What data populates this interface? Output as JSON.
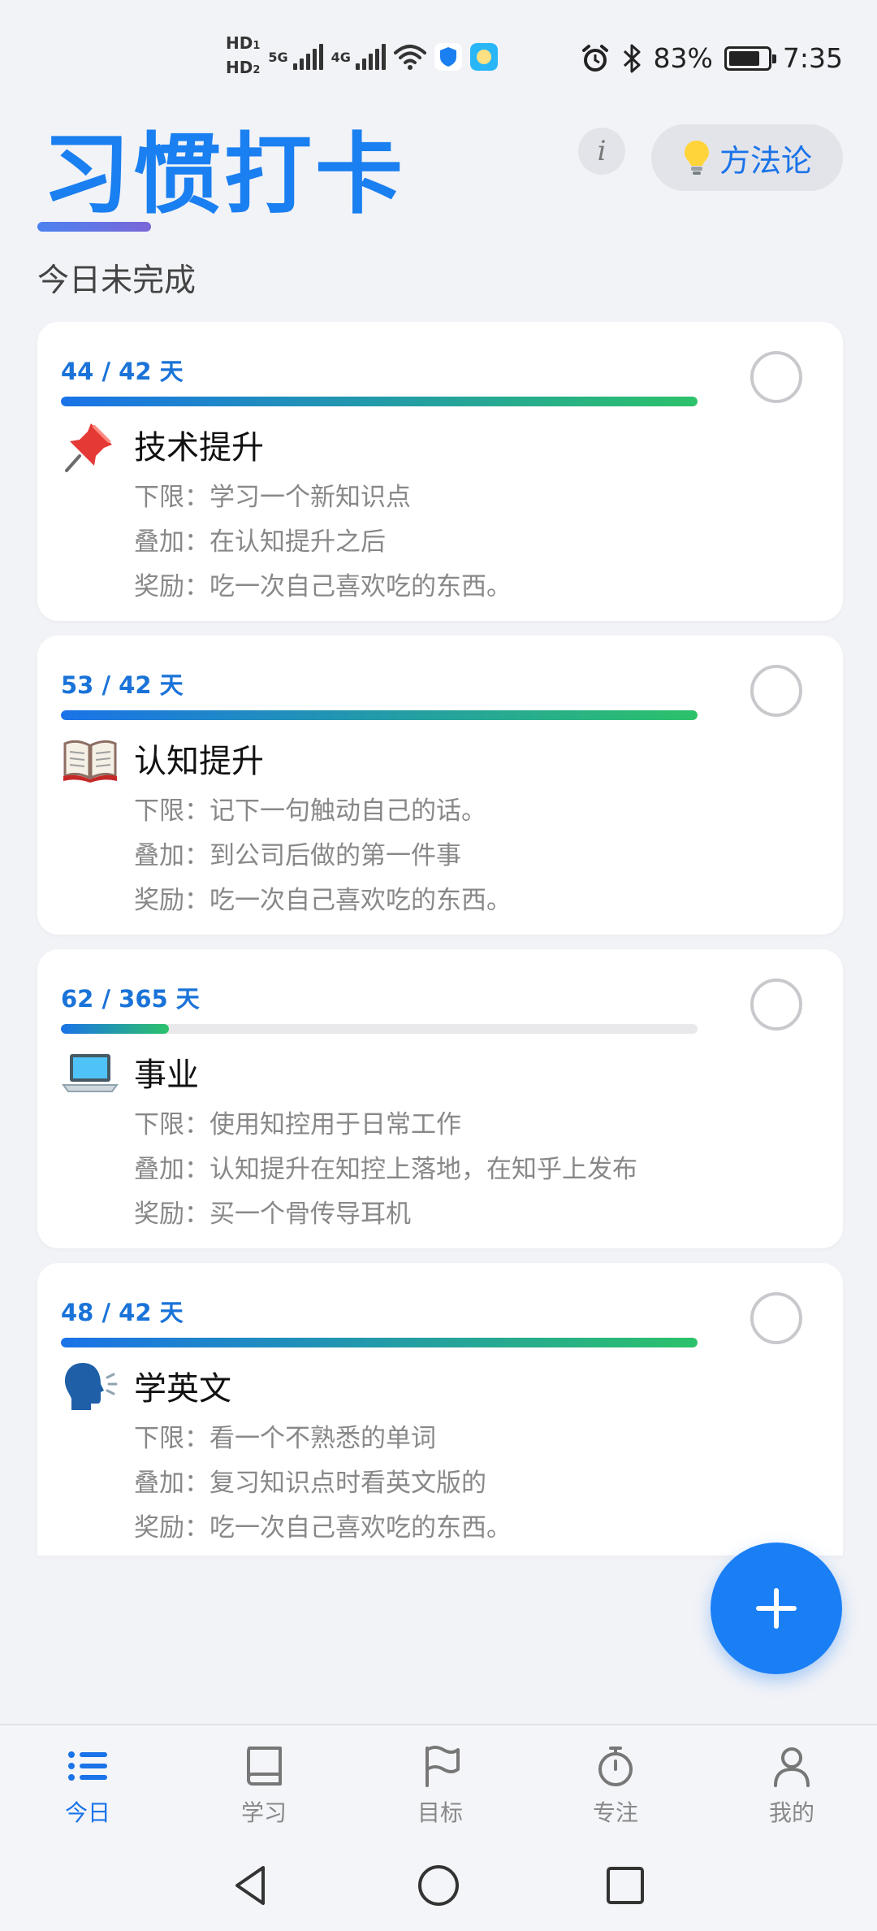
{
  "status_bar": {
    "hd1": "HD",
    "hd1_sub": "1",
    "hd2": "HD",
    "hd2_sub": "2",
    "net1": "5G",
    "net2": "4G",
    "battery_percent": "83%",
    "battery_level": 0.83,
    "time": "7:35"
  },
  "header": {
    "title": "习惯打卡",
    "info_label": "i",
    "method_label": "方法论"
  },
  "section_label": "今日未完成",
  "habits": [
    {
      "days": "44 / 42 天",
      "progress": 1.0,
      "icon": "pushpin-icon",
      "name": "技术提升",
      "lower": "下限：学习一个新知识点",
      "stack": "叠加：在认知提升之后",
      "reward": "奖励：吃一次自己喜欢吃的东西。"
    },
    {
      "days": "53 / 42 天",
      "progress": 1.0,
      "icon": "book-icon",
      "name": "认知提升",
      "lower": "下限：记下一句触动自己的话。",
      "stack": "叠加：到公司后做的第一件事",
      "reward": "奖励：吃一次自己喜欢吃的东西。"
    },
    {
      "days": "62 / 365 天",
      "progress": 0.17,
      "icon": "laptop-icon",
      "name": "事业",
      "lower": "下限：使用知控用于日常工作",
      "stack": "叠加：认知提升在知控上落地，在知乎上发布",
      "reward": "奖励：买一个骨传导耳机"
    },
    {
      "days": "48 / 42 天",
      "progress": 1.0,
      "icon": "speaking-head-icon",
      "name": "学英文",
      "lower": "下限：看一个不熟悉的单词",
      "stack": "叠加：复习知识点时看英文版的",
      "reward": "奖励：吃一次自己喜欢吃的东西。"
    }
  ],
  "bottom_nav": {
    "today": "今日",
    "study": "学习",
    "goals": "目标",
    "focus": "专注",
    "mine": "我的"
  },
  "colors": {
    "accent": "#1a7ff0",
    "progress_start": "#1a73e8",
    "progress_end": "#2cc26a"
  }
}
